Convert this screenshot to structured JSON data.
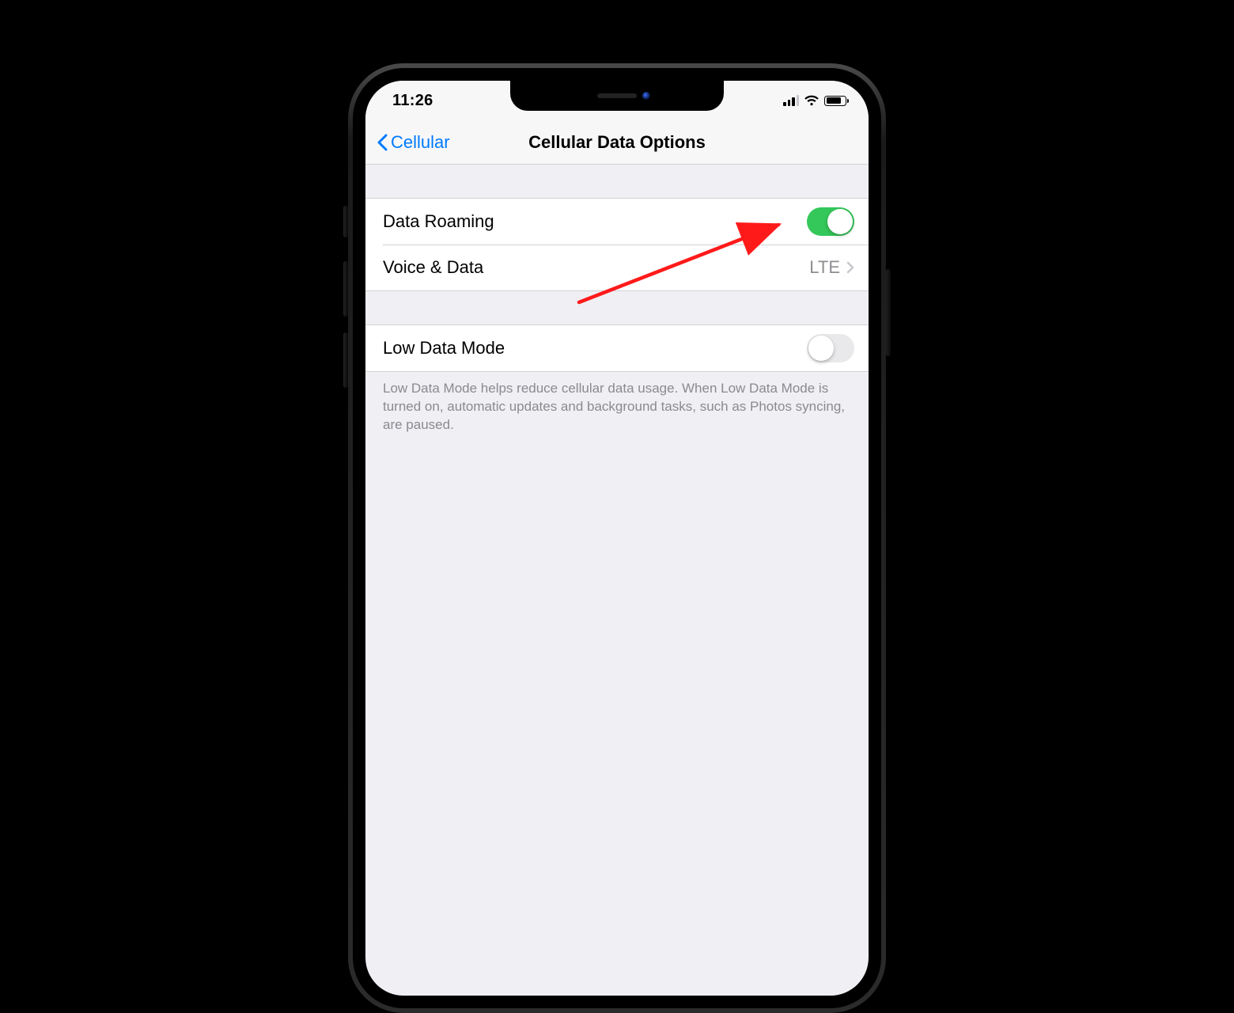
{
  "statusbar": {
    "time": "11:26"
  },
  "navbar": {
    "back_label": "Cellular",
    "title": "Cellular Data Options"
  },
  "group1": {
    "data_roaming": {
      "label": "Data Roaming",
      "on": true
    },
    "voice_data": {
      "label": "Voice & Data",
      "value": "LTE"
    }
  },
  "group2": {
    "low_data_mode": {
      "label": "Low Data Mode",
      "on": false
    },
    "footer": "Low Data Mode helps reduce cellular data usage. When Low Data Mode is turned on, automatic updates and background tasks, such as Photos syncing, are paused."
  },
  "annotation": {
    "arrow_color": "#ff1a1a"
  }
}
